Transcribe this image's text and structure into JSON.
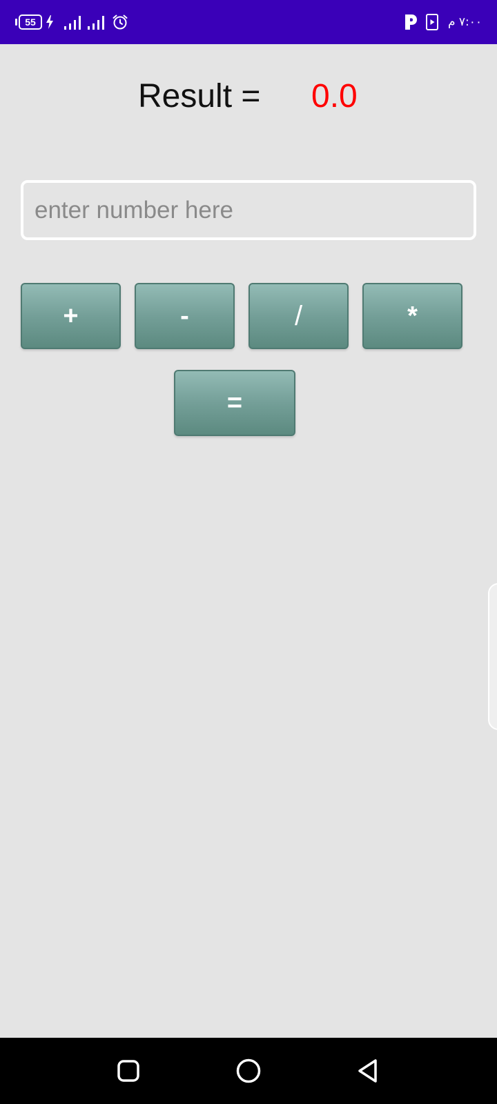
{
  "status_bar": {
    "battery_level": "55",
    "clock": "٧:٠٠ م",
    "icons": [
      "battery-icon",
      "charging-bolt-icon",
      "signal-icon",
      "signal-icon",
      "alarm-icon",
      "p-app-icon",
      "media-play-icon"
    ]
  },
  "result": {
    "label": "Result =",
    "value": "0.0",
    "value_color": "#ff0000"
  },
  "input": {
    "placeholder": "enter number here",
    "value": ""
  },
  "operators": {
    "plus": "+",
    "minus": "-",
    "divide": "/",
    "multiply": "*",
    "equals": "="
  },
  "nav_bar": {
    "icons": [
      "recents-icon",
      "home-icon",
      "back-icon"
    ]
  },
  "colors": {
    "status_bar": "#3a00b8",
    "background": "#e4e4e4",
    "button_gradient_top": "#93bbb5",
    "button_gradient_bottom": "#5c8a80"
  }
}
